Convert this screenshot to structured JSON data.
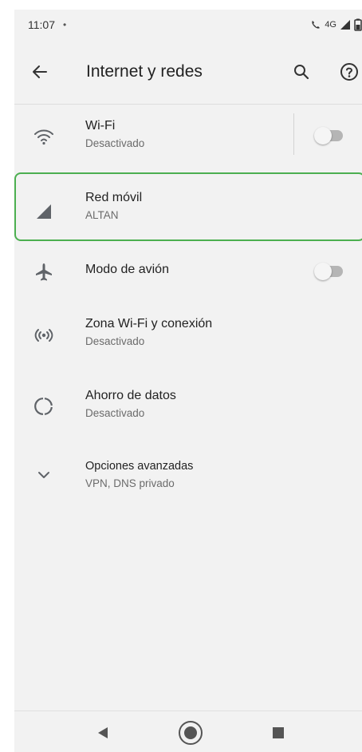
{
  "status_bar": {
    "time": "11:07",
    "notification_dot": "•",
    "network_type": "4G",
    "volte_label": "4G"
  },
  "toolbar": {
    "title": "Internet y redes",
    "back_icon": "arrow-back-icon",
    "search_icon": "search-icon",
    "help_icon": "help-icon"
  },
  "settings": {
    "items": [
      {
        "id": "wifi",
        "label": "Wi-Fi",
        "summary": "Desactivado",
        "icon": "wifi-icon",
        "toggle": false
      },
      {
        "id": "mobile",
        "label": "Red móvil",
        "summary": "ALTAN",
        "icon": "cell-signal-icon"
      },
      {
        "id": "airplane",
        "label": "Modo de avión",
        "summary": "",
        "icon": "airplane-icon",
        "toggle": false
      },
      {
        "id": "hotspot",
        "label": "Zona Wi-Fi y conexión",
        "summary": "Desactivado",
        "icon": "hotspot-icon"
      },
      {
        "id": "datasaver",
        "label": "Ahorro de datos",
        "summary": "Desactivado",
        "icon": "data-saver-icon"
      },
      {
        "id": "advanced",
        "label": "Opciones avanzadas",
        "summary": "VPN, DNS privado",
        "icon": "chevron-down-icon"
      }
    ]
  },
  "colors": {
    "highlight": "#4caf50",
    "background": "#f2f2f2",
    "icon": "#5f6368"
  }
}
